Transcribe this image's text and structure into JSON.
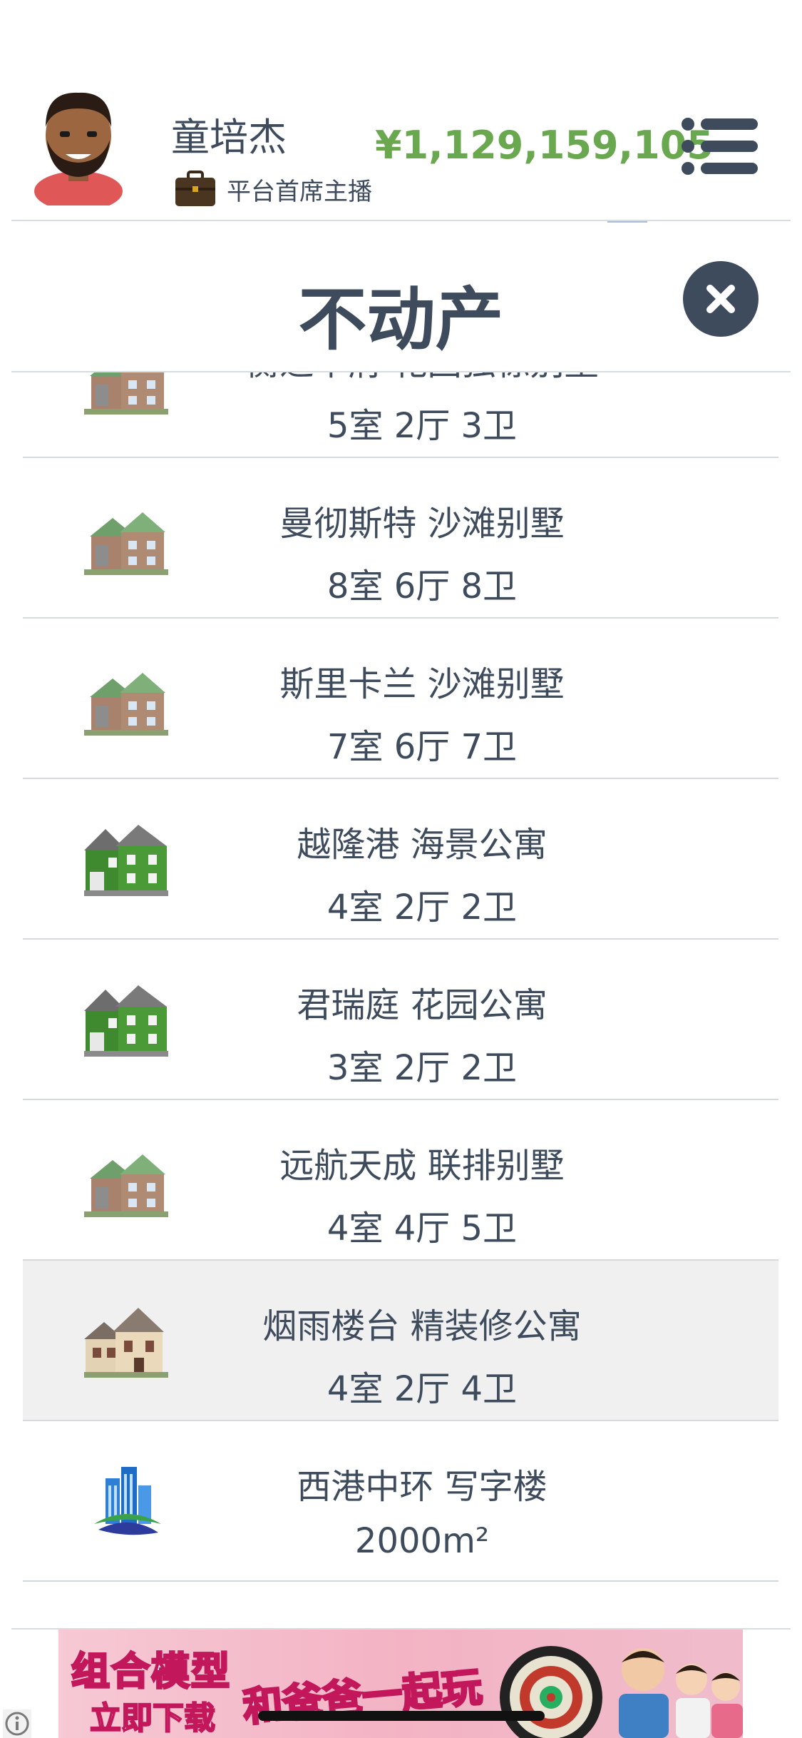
{
  "header": {
    "name": "童培杰",
    "subtitle": "平台首席主播",
    "balance": "¥1,129,159,105"
  },
  "panel": {
    "title": "不动产"
  },
  "properties": [
    {
      "name": "衡达华府 花园独栋别墅",
      "layout": "5室 2厅 3卫",
      "icon": "villa-house-icon"
    },
    {
      "name": "曼彻斯特 沙滩别墅",
      "layout": "8室 6厅 8卫",
      "icon": "villa-house-icon"
    },
    {
      "name": "斯里卡兰 沙滩别墅",
      "layout": "7室 6厅 7卫",
      "icon": "villa-house-icon"
    },
    {
      "name": "越隆港 海景公寓",
      "layout": "4室 2厅 2卫",
      "icon": "green-apartment-icon"
    },
    {
      "name": "君瑞庭 花园公寓",
      "layout": "3室 2厅 2卫",
      "icon": "green-apartment-icon"
    },
    {
      "name": "远航天成 联排别墅",
      "layout": "4室 4厅 5卫",
      "icon": "villa-house-icon"
    },
    {
      "name": "烟雨楼台 精装修公寓",
      "layout": "4室 2厅 4卫",
      "icon": "beige-house-icon",
      "selected": true
    },
    {
      "name": "西港中环 写字楼",
      "layout": "2000m²",
      "icon": "office-building-icon"
    }
  ],
  "ad": {
    "text1": "组合模型",
    "text2": "立即下载",
    "text3": "和爸爸一起玩"
  },
  "colors": {
    "balance": "#6aa84f",
    "text": "#3d4b5c",
    "close_button": "#3d4b5c",
    "selected_row": "#f0f0f0"
  }
}
